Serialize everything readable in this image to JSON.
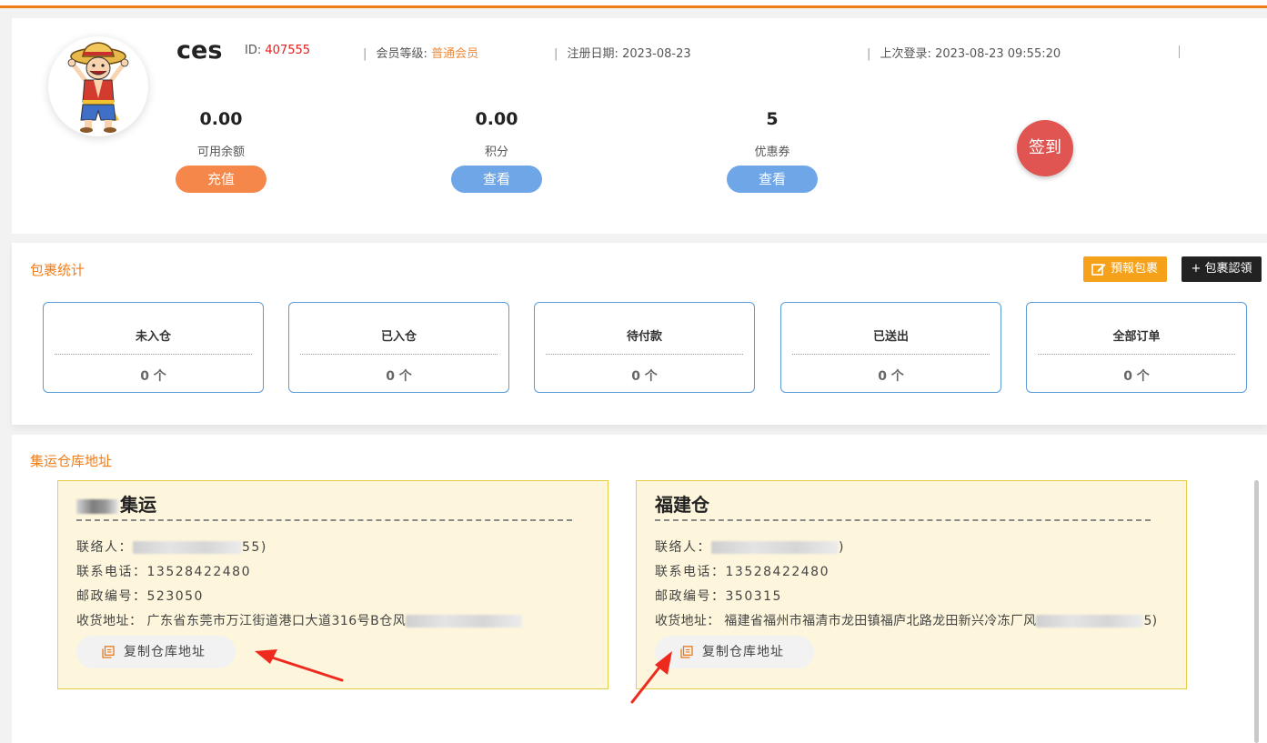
{
  "user": {
    "name": "ces",
    "id_label": "ID:",
    "id_value": "407555",
    "level_label": "会员等级:",
    "level_value": "普通会员",
    "reg_label": "注册日期:",
    "reg_value": "2023-08-23",
    "last_login_label": "上次登录:",
    "last_login_value": "2023-08-23 09:55:20"
  },
  "stats": [
    {
      "value": "0.00",
      "label": "可用余额",
      "button": "充值"
    },
    {
      "value": "0.00",
      "label": "积分",
      "button": "查看"
    },
    {
      "value": "5",
      "label": "优惠券",
      "button": "查看"
    }
  ],
  "signin_label": "签到",
  "packages": {
    "title": "包裹统计",
    "prereport_label": "預報包裹",
    "claim_label": "+ 包裹認領",
    "boxes": [
      {
        "title": "未入仓",
        "count": "0 个"
      },
      {
        "title": "已入仓",
        "count": "0 个"
      },
      {
        "title": "待付款",
        "count": "0 个"
      },
      {
        "title": "已送出",
        "count": "0 个"
      },
      {
        "title": "全部订单",
        "count": "0 个"
      }
    ]
  },
  "warehouse": {
    "title": "集运仓库地址",
    "items": [
      {
        "name": "集运",
        "contact_label": "联络人：",
        "contact_tail": "55)",
        "phone_label": "联系电话：",
        "phone": "13528422480",
        "zip_label": "邮政编号：",
        "zip": "523050",
        "addr_label": "收货地址：",
        "addr": "广东省东莞市万江街道港口大道316号B仓风",
        "addr_tail": "",
        "copy_label": "复制仓库地址"
      },
      {
        "name": "福建仓",
        "contact_label": "联络人：",
        "contact_tail": ")",
        "phone_label": "联系电话：",
        "phone": "13528422480",
        "zip_label": "邮政编号：",
        "zip": "350315",
        "addr_label": "收货地址：",
        "addr": "福建省福州市福清市龙田镇福庐北路龙田新兴冷冻厂风",
        "addr_tail": "5)",
        "copy_label": "复制仓库地址"
      }
    ]
  },
  "colors": {
    "accent": "#f07d1a",
    "blue": "#6ea6e8",
    "signin": "#e05552",
    "arrow": "#ee2a1e"
  }
}
